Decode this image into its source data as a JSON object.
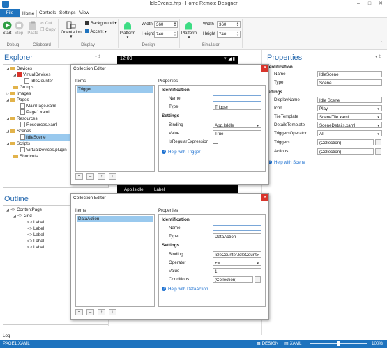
{
  "app": {
    "title": "IdleEvents.hrp - Home Remote Designer"
  },
  "menu": {
    "file": "File",
    "home": "Home",
    "controls": "Controls",
    "settings": "Settings",
    "view": "View"
  },
  "ribbon": {
    "start": "Start",
    "stop": "Stop",
    "debug": "Debug",
    "paste": "Paste",
    "cut": "Cut",
    "copy": "Copy",
    "clipboard": "Clipboard",
    "orientation": "Orientation",
    "background": "Background",
    "accent": "Accent",
    "display": "Display",
    "platform": "Platform",
    "width_label": "Width",
    "height_label": "Height",
    "design": {
      "width": "360",
      "height": "740",
      "label": "Design"
    },
    "simulator": {
      "width": "360",
      "height": "740",
      "label": "Simulator"
    }
  },
  "explorer": {
    "title": "Explorer",
    "items": [
      "Devices",
      "VirtualDevices",
      "IdleCounter",
      "Groups",
      "Images",
      "Pages",
      "MainPage.xaml",
      "Page1.xaml",
      "Resources",
      "Resources.xaml",
      "Scenes",
      "IdleScene",
      "Scripts",
      "VirtualDevices.plugin",
      "Shortcuts"
    ]
  },
  "outline": {
    "title": "Outline",
    "items": [
      "ContentPage",
      "Grid",
      "Label",
      "Label",
      "Label",
      "Label",
      "Label"
    ]
  },
  "phone": {
    "time": "12:00",
    "footer_left": "App.IsIdle",
    "footer_right": "Label"
  },
  "dialog1": {
    "title": "Collection Editor",
    "items_label": "Items",
    "properties_label": "Properties",
    "selected_item": "Trigger",
    "identification": "Identification",
    "name_label": "Name",
    "name_value": "",
    "type_label": "Type",
    "type_value": "Trigger",
    "settings": "Settings",
    "binding_label": "Binding",
    "binding_value": "App.IsIdle",
    "value_label": "Value",
    "value_value": "True",
    "isregex_label": "IsRegularExpression",
    "help": "Help with Trigger"
  },
  "dialog2": {
    "title": "Collection Editor",
    "items_label": "Items",
    "properties_label": "Properties",
    "selected_item": "DataAction",
    "identification": "Identification",
    "name_label": "Name",
    "name_value": "",
    "type_label": "Type",
    "type_value": "DataAction",
    "settings": "Settings",
    "binding_label": "Binding",
    "binding_value": "IdleCounter.IdleCount",
    "operator_label": "Operator",
    "operator_value": "+=",
    "value_label": "Value",
    "value_value": "1",
    "conditions_label": "Conditions",
    "conditions_value": "(Collection)",
    "help": "Help with DataAction"
  },
  "properties": {
    "title": "Properties",
    "identification": "Identification",
    "name_label": "Name",
    "name_value": "IdleScene",
    "type_label": "Type",
    "type_value": "Scene",
    "settings": "Settings",
    "rows": [
      {
        "label": "DisplayName",
        "value": "Idle Scene"
      },
      {
        "label": "Icon",
        "value": "Play"
      },
      {
        "label": "TileTemplate",
        "value": "SceneTile.xaml"
      },
      {
        "label": "DetailsTemplate",
        "value": "SceneDetails.xaml"
      },
      {
        "label": "TriggersOperator",
        "value": "All"
      },
      {
        "label": "Triggers",
        "value": "(Collection)"
      },
      {
        "label": "Actions",
        "value": "(Collection)"
      }
    ],
    "help": "Help with Scene"
  },
  "log": {
    "label": "Log"
  },
  "status": {
    "page": "PAGE1.XAML",
    "design": "DESIGN",
    "xaml": "XAML",
    "zoom": "100%"
  },
  "colors": {
    "accent": "#1e73be",
    "title_blue": "#2b6cb0",
    "selection": "#99c9ee",
    "close_red": "#d9342b"
  }
}
